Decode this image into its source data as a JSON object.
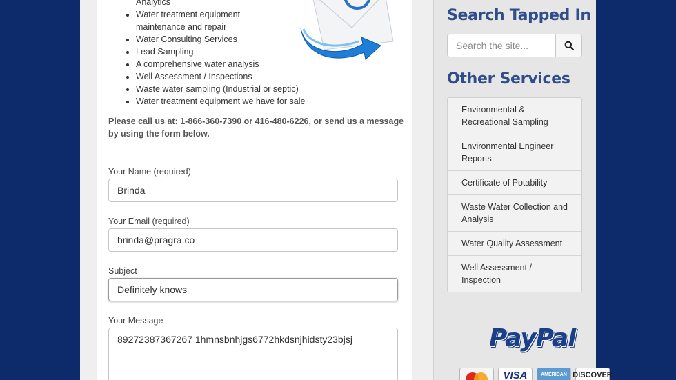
{
  "services_list": [
    "Analytics",
    "Water treatment equipment",
    "maintenance and repair",
    "Water Consulting Services",
    "Lead Sampling",
    "A comprehensive water analysis",
    "Well Assessment / Inspections",
    "Waste water sampling (Industrial or septic)",
    "Water treatment equipment we have for sale"
  ],
  "callout": "Please call us at: 1-866-360-7390 or 416-480-6226, or send us a message by using the form below.",
  "form": {
    "name_label": "Your Name (required)",
    "name_value": "Brinda",
    "email_label": "Your Email (required)",
    "email_value": "brinda@pragra.co",
    "subject_label": "Subject",
    "subject_value": "Definitely knows",
    "message_label": "Your Message",
    "message_value": "89272387367267 1hmnsbnhjgs6772hkdsnjhidsty23bjsj"
  },
  "sidebar": {
    "search_heading": "Search Tapped In",
    "search_placeholder": "Search the site...",
    "services_heading": "Other Services",
    "services": [
      "Environmental & Recreational Sampling",
      "Environmental Engineer Reports",
      "Certificate of Potability",
      "Waste Water Collection and Analysis",
      "Water Quality Assessment",
      "Well Assessment / Inspection"
    ],
    "paypal_label": "PayPal",
    "cards": [
      "MasterCard",
      "VISA",
      "AMERICAN",
      "DISCOVER"
    ]
  },
  "colors": {
    "background": "#0d2a6b",
    "heading": "#2f4d8a",
    "paypal": "#1b3f87"
  }
}
